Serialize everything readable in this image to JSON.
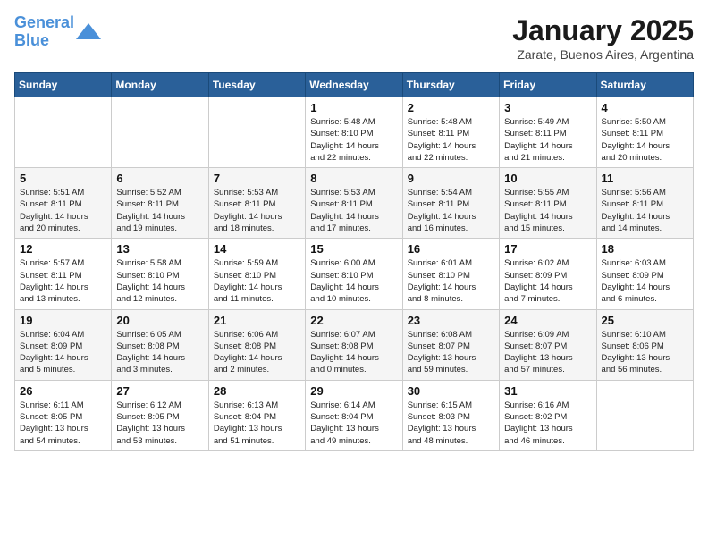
{
  "header": {
    "logo_line1": "General",
    "logo_line2": "Blue",
    "month": "January 2025",
    "location": "Zarate, Buenos Aires, Argentina"
  },
  "weekdays": [
    "Sunday",
    "Monday",
    "Tuesday",
    "Wednesday",
    "Thursday",
    "Friday",
    "Saturday"
  ],
  "weeks": [
    [
      {
        "day": "",
        "info": ""
      },
      {
        "day": "",
        "info": ""
      },
      {
        "day": "",
        "info": ""
      },
      {
        "day": "1",
        "info": "Sunrise: 5:48 AM\nSunset: 8:10 PM\nDaylight: 14 hours\nand 22 minutes."
      },
      {
        "day": "2",
        "info": "Sunrise: 5:48 AM\nSunset: 8:11 PM\nDaylight: 14 hours\nand 22 minutes."
      },
      {
        "day": "3",
        "info": "Sunrise: 5:49 AM\nSunset: 8:11 PM\nDaylight: 14 hours\nand 21 minutes."
      },
      {
        "day": "4",
        "info": "Sunrise: 5:50 AM\nSunset: 8:11 PM\nDaylight: 14 hours\nand 20 minutes."
      }
    ],
    [
      {
        "day": "5",
        "info": "Sunrise: 5:51 AM\nSunset: 8:11 PM\nDaylight: 14 hours\nand 20 minutes."
      },
      {
        "day": "6",
        "info": "Sunrise: 5:52 AM\nSunset: 8:11 PM\nDaylight: 14 hours\nand 19 minutes."
      },
      {
        "day": "7",
        "info": "Sunrise: 5:53 AM\nSunset: 8:11 PM\nDaylight: 14 hours\nand 18 minutes."
      },
      {
        "day": "8",
        "info": "Sunrise: 5:53 AM\nSunset: 8:11 PM\nDaylight: 14 hours\nand 17 minutes."
      },
      {
        "day": "9",
        "info": "Sunrise: 5:54 AM\nSunset: 8:11 PM\nDaylight: 14 hours\nand 16 minutes."
      },
      {
        "day": "10",
        "info": "Sunrise: 5:55 AM\nSunset: 8:11 PM\nDaylight: 14 hours\nand 15 minutes."
      },
      {
        "day": "11",
        "info": "Sunrise: 5:56 AM\nSunset: 8:11 PM\nDaylight: 14 hours\nand 14 minutes."
      }
    ],
    [
      {
        "day": "12",
        "info": "Sunrise: 5:57 AM\nSunset: 8:11 PM\nDaylight: 14 hours\nand 13 minutes."
      },
      {
        "day": "13",
        "info": "Sunrise: 5:58 AM\nSunset: 8:10 PM\nDaylight: 14 hours\nand 12 minutes."
      },
      {
        "day": "14",
        "info": "Sunrise: 5:59 AM\nSunset: 8:10 PM\nDaylight: 14 hours\nand 11 minutes."
      },
      {
        "day": "15",
        "info": "Sunrise: 6:00 AM\nSunset: 8:10 PM\nDaylight: 14 hours\nand 10 minutes."
      },
      {
        "day": "16",
        "info": "Sunrise: 6:01 AM\nSunset: 8:10 PM\nDaylight: 14 hours\nand 8 minutes."
      },
      {
        "day": "17",
        "info": "Sunrise: 6:02 AM\nSunset: 8:09 PM\nDaylight: 14 hours\nand 7 minutes."
      },
      {
        "day": "18",
        "info": "Sunrise: 6:03 AM\nSunset: 8:09 PM\nDaylight: 14 hours\nand 6 minutes."
      }
    ],
    [
      {
        "day": "19",
        "info": "Sunrise: 6:04 AM\nSunset: 8:09 PM\nDaylight: 14 hours\nand 5 minutes."
      },
      {
        "day": "20",
        "info": "Sunrise: 6:05 AM\nSunset: 8:08 PM\nDaylight: 14 hours\nand 3 minutes."
      },
      {
        "day": "21",
        "info": "Sunrise: 6:06 AM\nSunset: 8:08 PM\nDaylight: 14 hours\nand 2 minutes."
      },
      {
        "day": "22",
        "info": "Sunrise: 6:07 AM\nSunset: 8:08 PM\nDaylight: 14 hours\nand 0 minutes."
      },
      {
        "day": "23",
        "info": "Sunrise: 6:08 AM\nSunset: 8:07 PM\nDaylight: 13 hours\nand 59 minutes."
      },
      {
        "day": "24",
        "info": "Sunrise: 6:09 AM\nSunset: 8:07 PM\nDaylight: 13 hours\nand 57 minutes."
      },
      {
        "day": "25",
        "info": "Sunrise: 6:10 AM\nSunset: 8:06 PM\nDaylight: 13 hours\nand 56 minutes."
      }
    ],
    [
      {
        "day": "26",
        "info": "Sunrise: 6:11 AM\nSunset: 8:05 PM\nDaylight: 13 hours\nand 54 minutes."
      },
      {
        "day": "27",
        "info": "Sunrise: 6:12 AM\nSunset: 8:05 PM\nDaylight: 13 hours\nand 53 minutes."
      },
      {
        "day": "28",
        "info": "Sunrise: 6:13 AM\nSunset: 8:04 PM\nDaylight: 13 hours\nand 51 minutes."
      },
      {
        "day": "29",
        "info": "Sunrise: 6:14 AM\nSunset: 8:04 PM\nDaylight: 13 hours\nand 49 minutes."
      },
      {
        "day": "30",
        "info": "Sunrise: 6:15 AM\nSunset: 8:03 PM\nDaylight: 13 hours\nand 48 minutes."
      },
      {
        "day": "31",
        "info": "Sunrise: 6:16 AM\nSunset: 8:02 PM\nDaylight: 13 hours\nand 46 minutes."
      },
      {
        "day": "",
        "info": ""
      }
    ]
  ]
}
